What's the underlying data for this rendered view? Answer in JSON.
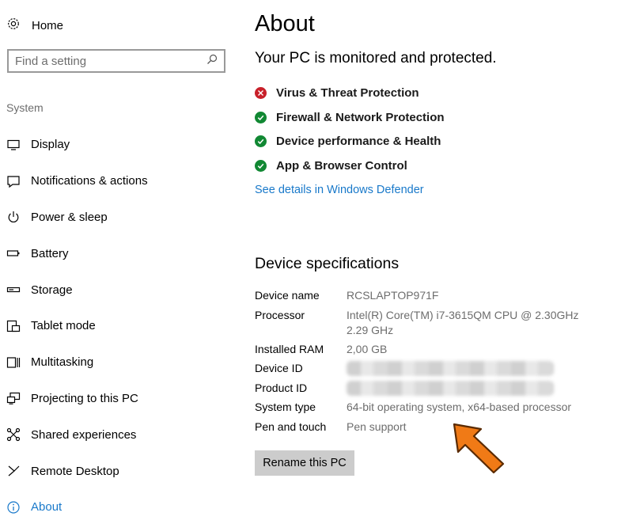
{
  "sidebar": {
    "home_label": "Home",
    "search_placeholder": "Find a setting",
    "section_label": "System",
    "items": [
      {
        "label": "Display",
        "icon": "display-icon"
      },
      {
        "label": "Notifications & actions",
        "icon": "notifications-icon"
      },
      {
        "label": "Power & sleep",
        "icon": "power-icon"
      },
      {
        "label": "Battery",
        "icon": "battery-icon"
      },
      {
        "label": "Storage",
        "icon": "storage-icon"
      },
      {
        "label": "Tablet mode",
        "icon": "tablet-mode-icon"
      },
      {
        "label": "Multitasking",
        "icon": "multitasking-icon"
      },
      {
        "label": "Projecting to this PC",
        "icon": "projecting-icon"
      },
      {
        "label": "Shared experiences",
        "icon": "shared-experiences-icon"
      },
      {
        "label": "Remote Desktop",
        "icon": "remote-desktop-icon"
      },
      {
        "label": "About",
        "icon": "info-icon",
        "active": true
      }
    ]
  },
  "main": {
    "title": "About",
    "status_heading": "Your PC is monitored and protected.",
    "protection": [
      {
        "label": "Virus & Threat Protection",
        "status": "error"
      },
      {
        "label": "Firewall & Network Protection",
        "status": "ok"
      },
      {
        "label": "Device performance & Health",
        "status": "ok"
      },
      {
        "label": "App & Browser Control",
        "status": "ok"
      }
    ],
    "defender_link": "See details in Windows Defender",
    "specs_title": "Device specifications",
    "specs": {
      "device_name": {
        "key": "Device name",
        "value": "RCSLAPTOP971F"
      },
      "processor": {
        "key": "Processor",
        "value": "Intel(R) Core(TM) i7-3615QM CPU @ 2.30GHz 2.29 GHz"
      },
      "ram": {
        "key": "Installed RAM",
        "value": "2,00 GB"
      },
      "device_id": {
        "key": "Device ID"
      },
      "product_id": {
        "key": "Product ID"
      },
      "system_type": {
        "key": "System type",
        "value": "64-bit operating system, x64-based processor"
      },
      "pen_touch": {
        "key": "Pen and touch",
        "value": "Pen support"
      }
    },
    "rename_button": "Rename this PC"
  },
  "colors": {
    "accent": "#1979ca",
    "error": "#c8202a",
    "ok": "#118833",
    "annotation_arrow": "#f07a16"
  }
}
